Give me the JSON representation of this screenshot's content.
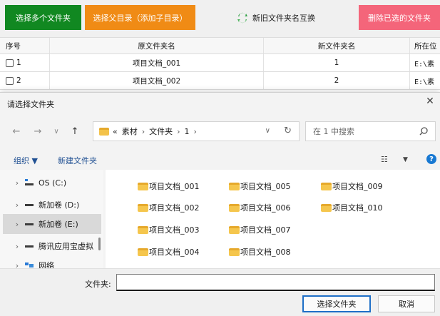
{
  "toolbar": {
    "select_multiple": "选择多个文件夹",
    "select_parent": "选择父目录（添加子目录）",
    "swap_names": "新旧文件夹名互换",
    "delete_selected": "删除已选的文件夹"
  },
  "table": {
    "headers": [
      "序号",
      "原文件夹名",
      "新文件夹名",
      "所在位"
    ],
    "rows": [
      {
        "index": "1",
        "old": "项目文档_001",
        "new": "1",
        "path": "E:\\素"
      },
      {
        "index": "2",
        "old": "项目文档_002",
        "new": "2",
        "path": "E:\\素"
      }
    ]
  },
  "dialog": {
    "title": "请选择文件夹",
    "close": "✕",
    "breadcrumb": {
      "prefix": "«",
      "segments": [
        "素材",
        "文件夹",
        "1"
      ],
      "separator": "›"
    },
    "search_placeholder": "在 1 中搜索",
    "commands": {
      "organize": "组织 ▼",
      "new_folder": "新建文件夹",
      "help": "?"
    },
    "nav_items": [
      {
        "label": "OS (C:)",
        "icon": "windows-drive-icon",
        "selected": false
      },
      {
        "label": "新加卷 (D:)",
        "icon": "drive-icon",
        "selected": false
      },
      {
        "label": "新加卷 (E:)",
        "icon": "drive-icon",
        "selected": true
      },
      {
        "label": "腾讯应用宝虚拟",
        "icon": "drive-icon",
        "selected": false
      },
      {
        "label": "网络",
        "icon": "network-icon",
        "selected": false
      }
    ],
    "folders": [
      "项目文档_001",
      "项目文档_005",
      "项目文档_009",
      "项目文档_002",
      "项目文档_006",
      "项目文档_010",
      "项目文档_003",
      "项目文档_007",
      "项目文档_004",
      "项目文档_008"
    ],
    "folder_label": "文件夹:",
    "folder_value": "",
    "select_button": "选择文件夹",
    "cancel_button": "取消"
  },
  "colors": {
    "green": "#118821",
    "orange": "#f08b15",
    "pink": "#f4657a",
    "folder": "#f5c64d",
    "accent": "#1e6fc7"
  }
}
